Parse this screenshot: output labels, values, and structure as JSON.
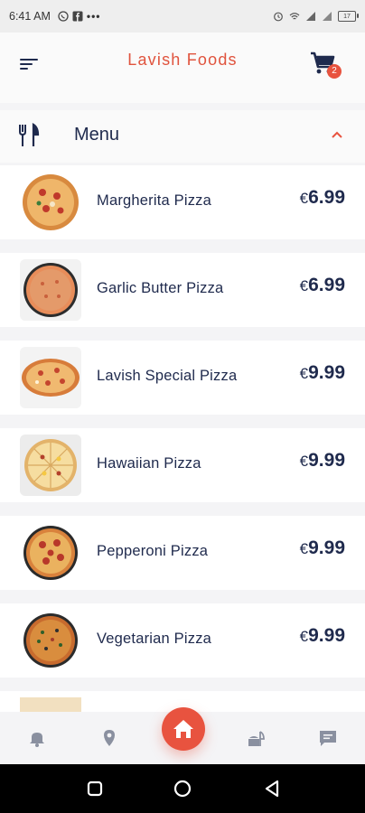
{
  "status_bar": {
    "time": "6:41 AM",
    "more": "•••",
    "battery": "17"
  },
  "header": {
    "title": "Lavish Foods",
    "cart_count": "2",
    "accent_color": "#e8533f"
  },
  "section": {
    "label": "Menu"
  },
  "menu_items": [
    {
      "name": "Margherita Pizza",
      "currency": "€",
      "price": "6.99"
    },
    {
      "name": "Garlic Butter Pizza",
      "currency": "€",
      "price": "6.99"
    },
    {
      "name": "Lavish Special Pizza",
      "currency": "€",
      "price": "9.99"
    },
    {
      "name": "Hawaiian Pizza",
      "currency": "€",
      "price": "9.99"
    },
    {
      "name": "Pepperoni Pizza",
      "currency": "€",
      "price": "9.99"
    },
    {
      "name": "Vegetarian Pizza",
      "currency": "€",
      "price": "9.99"
    }
  ],
  "bottom_nav": [
    "bell-icon",
    "location-pin-icon",
    "home-icon",
    "food-icon",
    "chat-icon"
  ]
}
